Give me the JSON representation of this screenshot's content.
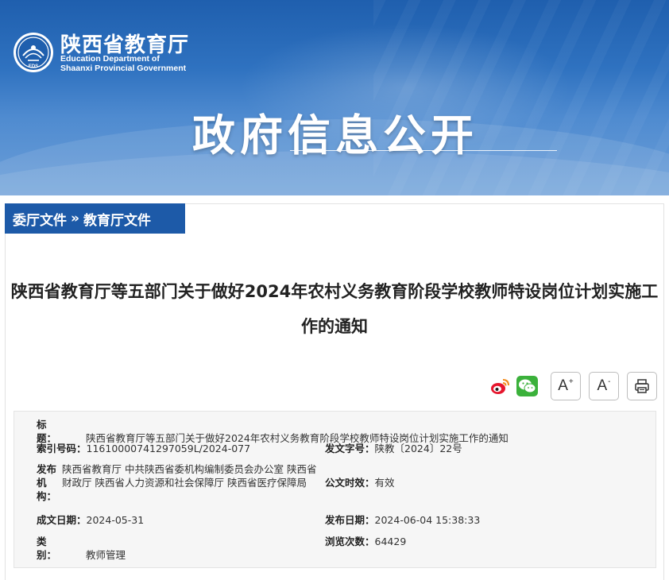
{
  "header": {
    "org_name_cn": "陕西省教育厅",
    "org_name_en_line1": "Education Department of",
    "org_name_en_line2": "Shaanxi Provincial Government",
    "logo_text": "EDS",
    "banner_title": "政府信息公开"
  },
  "breadcrumb": {
    "item1": "委厅文件",
    "separator": "»",
    "item2": "教育厅文件"
  },
  "document": {
    "title": "陕西省教育厅等五部门关于做好2024年农村义务教育阶段学校教师特设岗位计划实施工作的通知"
  },
  "tools": {
    "font_increase_label": "A",
    "font_increase_sup": "+",
    "font_decrease_label": "A",
    "font_decrease_sup": "-",
    "icons": [
      "weibo-share-icon",
      "wechat-share-icon",
      "printer-icon"
    ]
  },
  "meta": {
    "title_label": "标　　题：",
    "title_value": "陕西省教育厅等五部门关于做好2024年农村义务教育阶段学校教师特设岗位计划实施工作的通知",
    "index_label": "索引号码：",
    "index_value": "11610000741297059L/2024-077",
    "docno_label": "发文字号：",
    "docno_value": "陕教〔2024〕22号",
    "issuer_label": "发布机构：",
    "issuer_value": "陕西省教育厅 中共陕西省委机构编制委员会办公室 陕西省财政厅 陕西省人力资源和社会保障厅 陕西省医疗保障局",
    "valid_label": "公文时效：",
    "valid_value": "有效",
    "made_label": "成文日期：",
    "made_value": "2024-05-31",
    "pub_label": "发布日期：",
    "pub_value": "2024-06-04 15:38:33",
    "cat_label": "类　　别：",
    "cat_value": "教师管理",
    "views_label": "浏览次数：",
    "views_value": "64429"
  },
  "colors": {
    "banner_blue": "#1f5fae",
    "breadcrumb_blue": "#1d5aa8",
    "wechat_green": "#3bb13b",
    "weibo_red": "#e6162d"
  }
}
